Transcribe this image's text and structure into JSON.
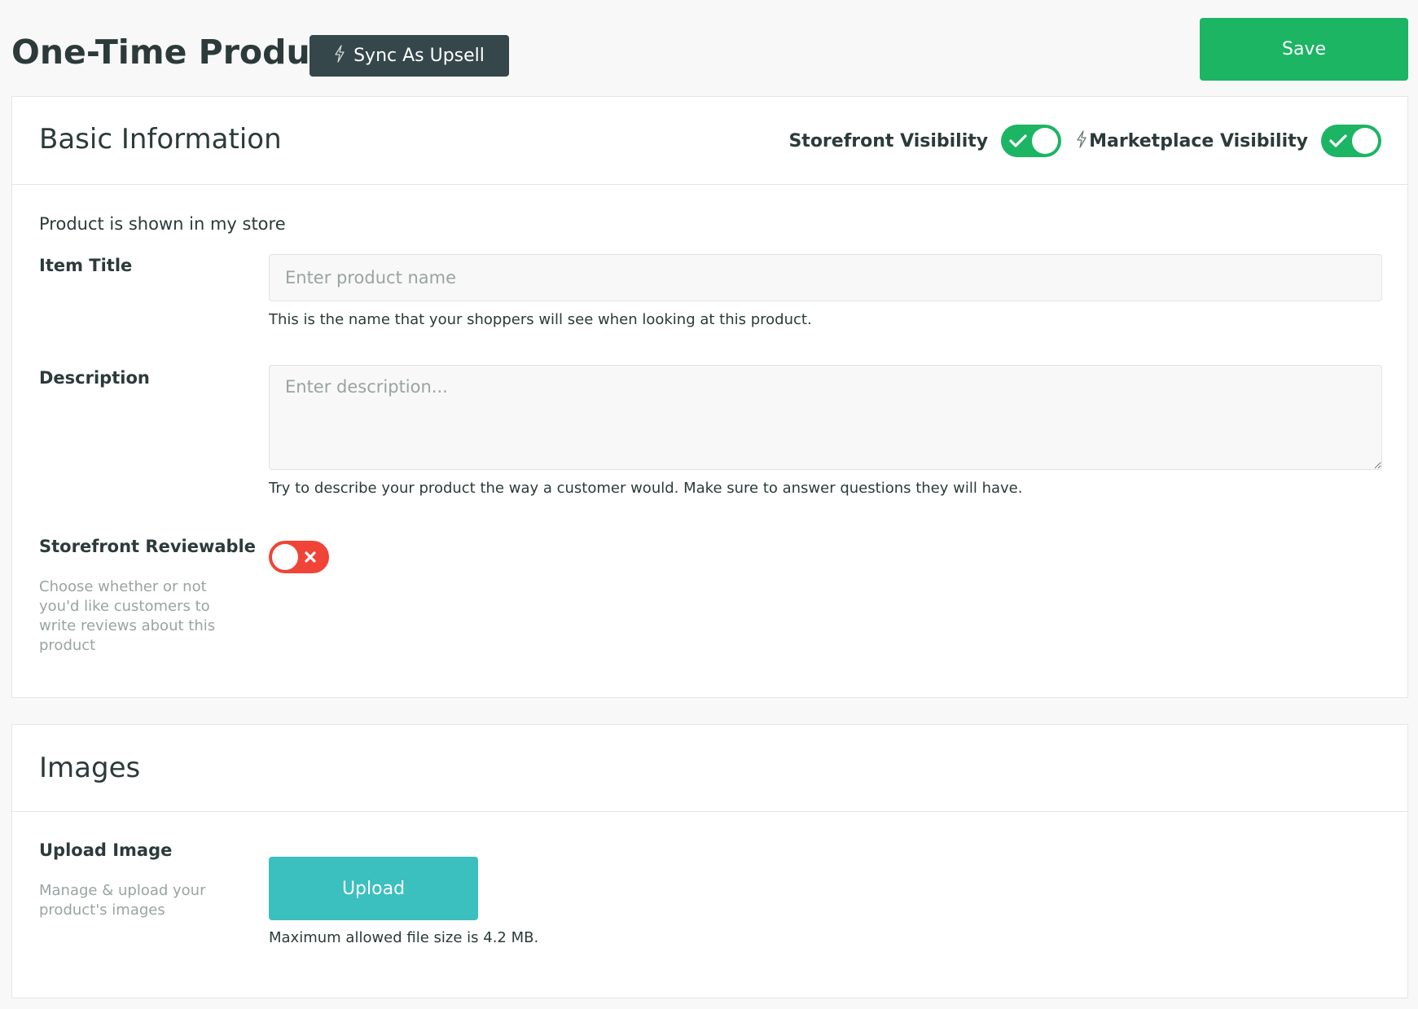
{
  "header": {
    "title": "One-Time Product",
    "sync_button_label": "Sync As Upsell",
    "save_button_label": "Save"
  },
  "basic_info": {
    "title": "Basic Information",
    "storefront_visibility_label": "Storefront Visibility",
    "storefront_visibility_on": true,
    "marketplace_visibility_label": "Marketplace Visibility",
    "marketplace_visibility_on": true,
    "shown_text": "Product is shown in my store",
    "item_title": {
      "label": "Item Title",
      "placeholder": "Enter product name",
      "value": "",
      "help": "This is the name that your shoppers will see when looking at this product."
    },
    "description": {
      "label": "Description",
      "placeholder": "Enter description...",
      "value": "",
      "help": "Try to describe your product the way a customer would. Make sure to answer questions they will have."
    },
    "reviewable": {
      "label": "Storefront Reviewable",
      "sub": "Choose whether or not you'd like customers to write reviews about this product",
      "on": false
    }
  },
  "images": {
    "title": "Images",
    "upload_label": "Upload Image",
    "upload_sub": "Manage & upload your product's images",
    "upload_button_label": "Upload",
    "max_size_text": "Maximum allowed file size is 4.2 MB."
  },
  "colors": {
    "save_green": "#1bb563",
    "sync_dark": "#35474a",
    "toggle_on": "#1bb563",
    "toggle_off": "#f04438",
    "upload_teal": "#3bbfbf"
  }
}
